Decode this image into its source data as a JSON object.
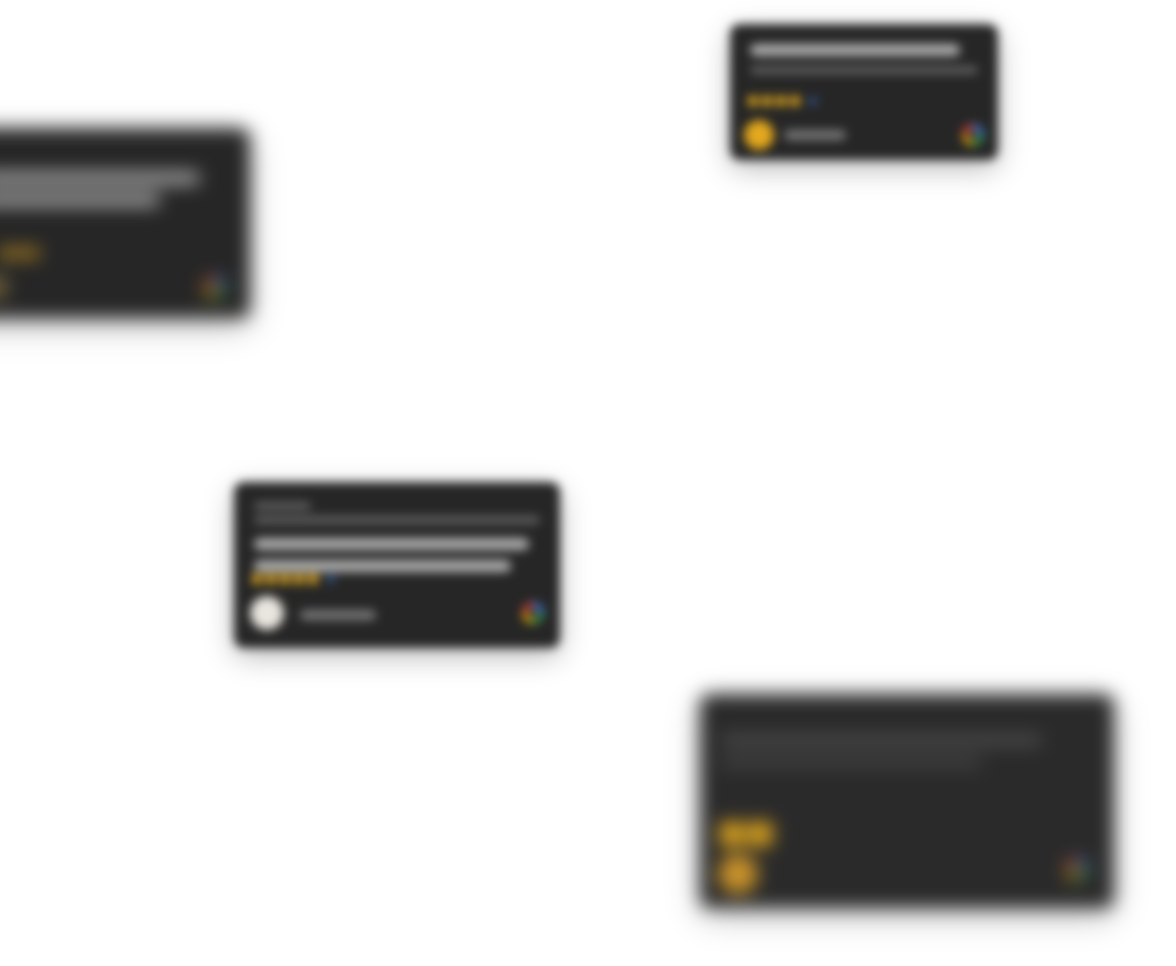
{
  "scene": {
    "background": "#ffffff"
  },
  "theme": {
    "card_background": "#262626",
    "star_color": "#e2a81e",
    "rating_dot_color": "#4285F4"
  },
  "cards": [
    {
      "id": "card-left",
      "review_lines": 2,
      "rating_stars": 5,
      "source_icon": "google-g-icon",
      "avatar_color": "#7a6a3a"
    },
    {
      "id": "card-top-right",
      "review_lines": 2,
      "rating_stars": 5,
      "source_icon": "google-g-icon",
      "avatar_color": "#e2a81e"
    },
    {
      "id": "card-center",
      "review_lines": 2,
      "rating_stars": 5,
      "source_icon": "google-g-icon",
      "avatar_color": "#e9e5df"
    },
    {
      "id": "card-bottom-right",
      "review_lines": 2,
      "rating_stars": 5,
      "source_icon": "google-g-icon",
      "avatar_color": "#c8922a"
    }
  ]
}
